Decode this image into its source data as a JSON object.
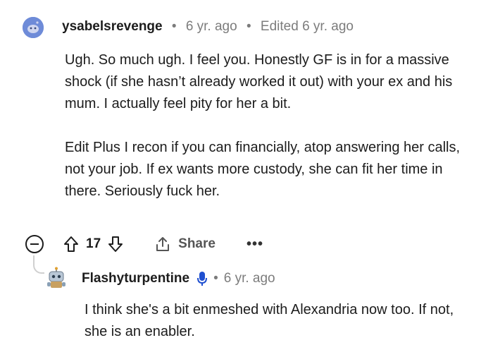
{
  "comment": {
    "username": "ysabelsrevenge",
    "separator": "•",
    "time": "6 yr. ago",
    "edited": "Edited 6 yr. ago",
    "paragraphs": [
      "Ugh. So much ugh. I feel you. Honestly GF is in for a massive shock (if she hasn’t already worked it out) with your ex and his mum. I actually feel pity for her a bit.",
      "Edit Plus I recon if you can financially, atop answering her calls, not your job. If ex wants more custody, she can fit her time in there. Seriously fuck her."
    ],
    "actions": {
      "vote_count": "17",
      "share_label": "Share",
      "more_label": "•••"
    }
  },
  "reply": {
    "username": "Flashyturpentine",
    "separator": "•",
    "time": "6 yr. ago",
    "body": "I think she's a bit enmeshed with Alexandria now too. If not, she is an enabler."
  },
  "colors": {
    "avatar_blue": "#6e8bd8",
    "mic_blue": "#1f4fd0",
    "text": "#1c1c1c",
    "meta": "#7c7c7c"
  }
}
